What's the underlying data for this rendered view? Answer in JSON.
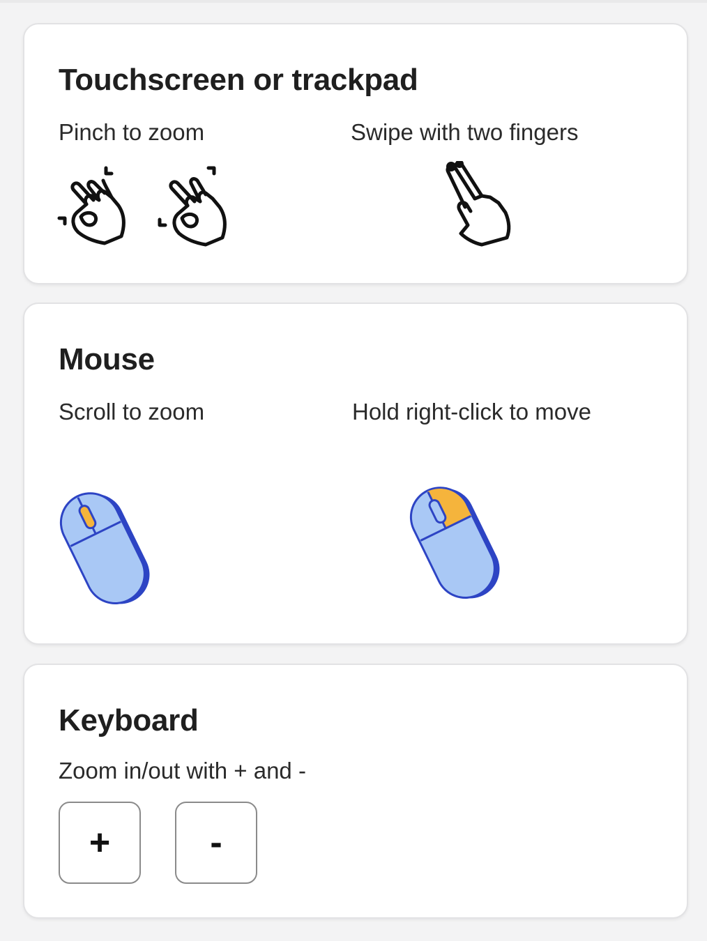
{
  "touch": {
    "title": "Touchscreen or trackpad",
    "pinch_label": "Pinch to zoom",
    "swipe_label": "Swipe with two fingers"
  },
  "mouse": {
    "title": "Mouse",
    "scroll_label": "Scroll to zoom",
    "rightclick_label": "Hold right-click to move"
  },
  "keyboard": {
    "title": "Keyboard",
    "label": "Zoom in/out with + and -",
    "plus_key": "+",
    "minus_key": "-"
  },
  "icons": {
    "pinch_in": "pinch-in-hand-icon",
    "pinch_out": "pinch-out-hand-icon",
    "two_finger_swipe": "two-finger-swipe-hand-icon",
    "mouse_scroll": "mouse-scroll-wheel-icon",
    "mouse_right_click": "mouse-right-click-icon"
  },
  "colors": {
    "mouse_body": "#a9c8f5",
    "mouse_outline": "#2d44c4",
    "highlight": "#f5b43c"
  }
}
